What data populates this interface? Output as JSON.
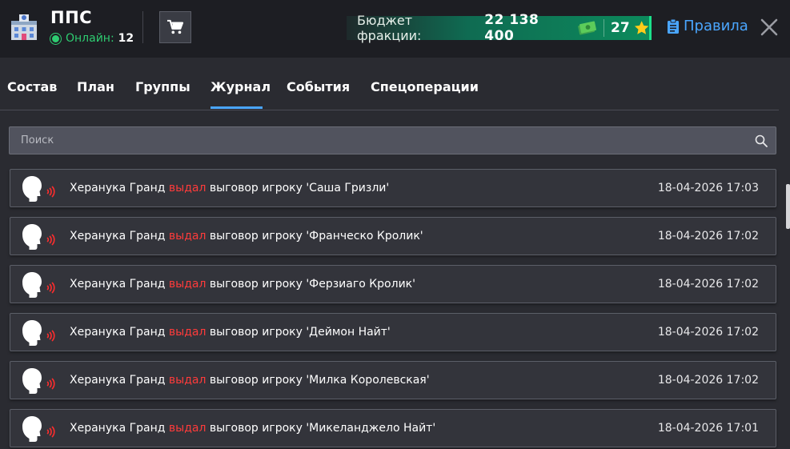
{
  "header": {
    "org_name": "ППС",
    "online_label": "Онлайн:",
    "online_count": "12",
    "budget_label": "Бюджет фракции:",
    "budget_value": "22 138 400",
    "stars_value": "27",
    "rules_label": "Правила",
    "icons": {
      "logo": "police-building-icon",
      "cart": "cart-icon",
      "money": "money-icon",
      "star": "star-icon",
      "rules": "document-icon",
      "close": "close-icon"
    }
  },
  "tabs": [
    {
      "label": "Состав"
    },
    {
      "label": "План"
    },
    {
      "label": "Группы"
    },
    {
      "label": "Журнал"
    },
    {
      "label": "События"
    },
    {
      "label": "Спецоперации"
    }
  ],
  "active_tab": "Журнал",
  "search": {
    "placeholder": "Поиск",
    "value": ""
  },
  "log": [
    {
      "actor": "Херанука Гранд",
      "action": "выдал",
      "rest": "выговор игроку 'Саша Гризли'",
      "time": "18-04-2026 17:03"
    },
    {
      "actor": "Херанука Гранд",
      "action": "выдал",
      "rest": "выговор игроку 'Франческо Кролик'",
      "time": "18-04-2026 17:02"
    },
    {
      "actor": "Херанука Гранд",
      "action": "выдал",
      "rest": "выговор игроку 'Ферзиаго Кролик'",
      "time": "18-04-2026 17:02"
    },
    {
      "actor": "Херанука Гранд",
      "action": "выдал",
      "rest": "выговор игроку 'Деймон Найт'",
      "time": "18-04-2026 17:02"
    },
    {
      "actor": "Херанука Гранд",
      "action": "выдал",
      "rest": "выговор игроку 'Милка Королевская'",
      "time": "18-04-2026 17:02"
    },
    {
      "actor": "Херанука Гранд",
      "action": "выдал",
      "rest": "выговор игроку 'Микеланджело Найт'",
      "time": "18-04-2026 17:01"
    }
  ],
  "colors": {
    "accent": "#4aa6ff",
    "action": "#ff3b3b",
    "online": "#2ecc71",
    "budget": "#0c8a5c"
  }
}
